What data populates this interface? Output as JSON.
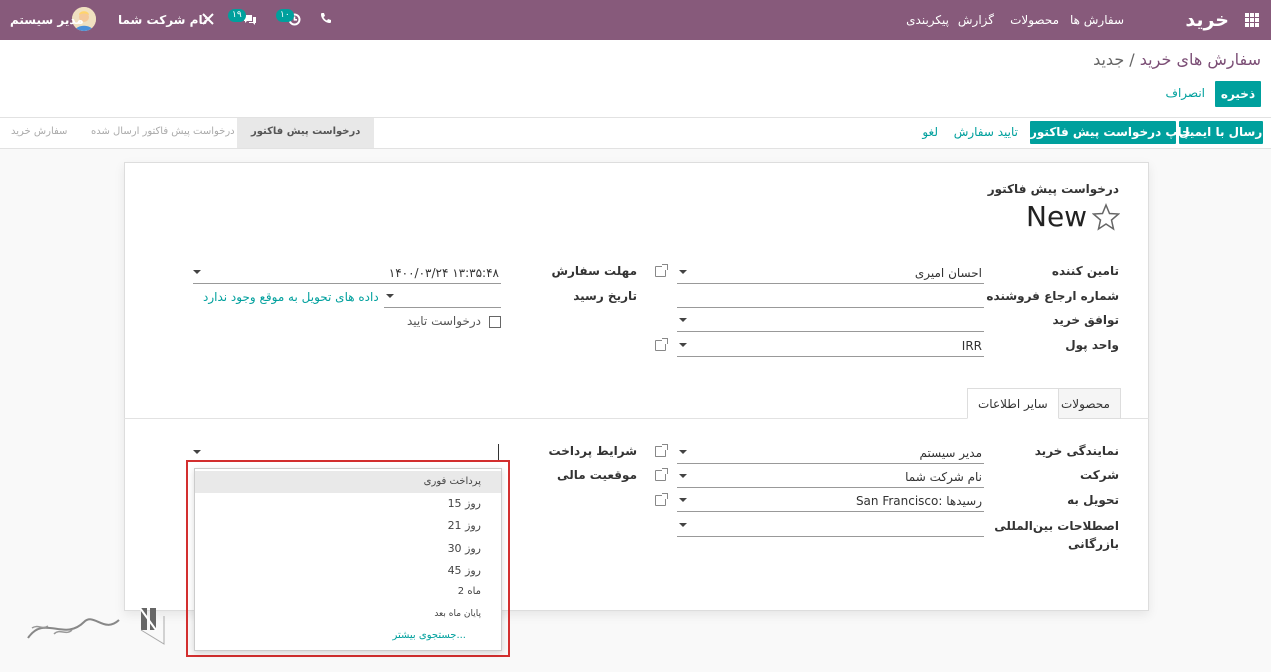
{
  "topbar": {
    "app_title": "خرید",
    "menu": [
      "سفارش ها",
      "محصولات",
      "گزارش",
      "پیکربندی"
    ],
    "user_name": "مدیر سیستم",
    "company_name": "نام شرکت شما",
    "messages_count": "۱۹",
    "activities_count": "۱۰",
    "icons": [
      "apps-grid-icon",
      "phone-icon",
      "clock-icon",
      "chat-icon",
      "tools-icon",
      "avatar"
    ]
  },
  "breadcrumb": {
    "parent": "سفارش های خرید",
    "separator": "/",
    "current": "جدید"
  },
  "actions": {
    "save": "ذخیره",
    "discard": "انصراف"
  },
  "buttons": {
    "send_email": "ارسال با ایمیل",
    "print_rfq": "چاپ درخواست پیش فاکتور",
    "confirm_order": "تایید سفارش",
    "cancel": "لغو"
  },
  "statusbar": [
    "درخواست پیش فاکتور",
    "درخواست پیش فاکتور ارسال شده",
    "سفارش خرید"
  ],
  "form": {
    "doc_type": "درخواست پیش فاکتور",
    "doc_name": "New",
    "labels": {
      "vendor": "تامین کننده",
      "vendor_ref": "شماره ارجاع فروشنده",
      "agreement": "توافق خرید",
      "currency": "واحد پول",
      "order_deadline": "مهلت سفارش",
      "receipt_date": "تاریخ رسید",
      "ask_confirmation": "درخواست تایید"
    },
    "values": {
      "vendor": "احسان امیری",
      "currency": "IRR",
      "order_deadline": "۱۴۰۰/۰۳/۲۴ ۱۳:۳۵:۴۸",
      "receipt_date": "داده های تحویل به موقع وجود ندارد"
    }
  },
  "tabs": {
    "products": "محصولات",
    "other_info": "سایر اطلاعات"
  },
  "other_info": {
    "labels": {
      "buyer": "نمایندگی خرید",
      "company": "شرکت",
      "deliver_to": "تحویل به",
      "incoterm_line1": "اصطلاحات بین‌المللی",
      "incoterm_line2": "بازرگانی",
      "payment_terms": "شرایط پرداخت",
      "fiscal_position": "موقعیت مالی"
    },
    "values": {
      "buyer": "مدیر سیستم",
      "company": "نام شرکت شما",
      "deliver_to": "San Francisco: رسیدها"
    }
  },
  "dropdown": {
    "items": [
      "پرداخت فوری",
      "15 روز",
      "21 روز",
      "30 روز",
      "45 روز",
      "2 ماه",
      "پایان ماه بعد"
    ],
    "search_more": "جستجوی بیشتر..."
  },
  "colors": {
    "topbar": "#875A7B",
    "primary": "#00A09D",
    "highlight_border": "#d32f2f"
  }
}
